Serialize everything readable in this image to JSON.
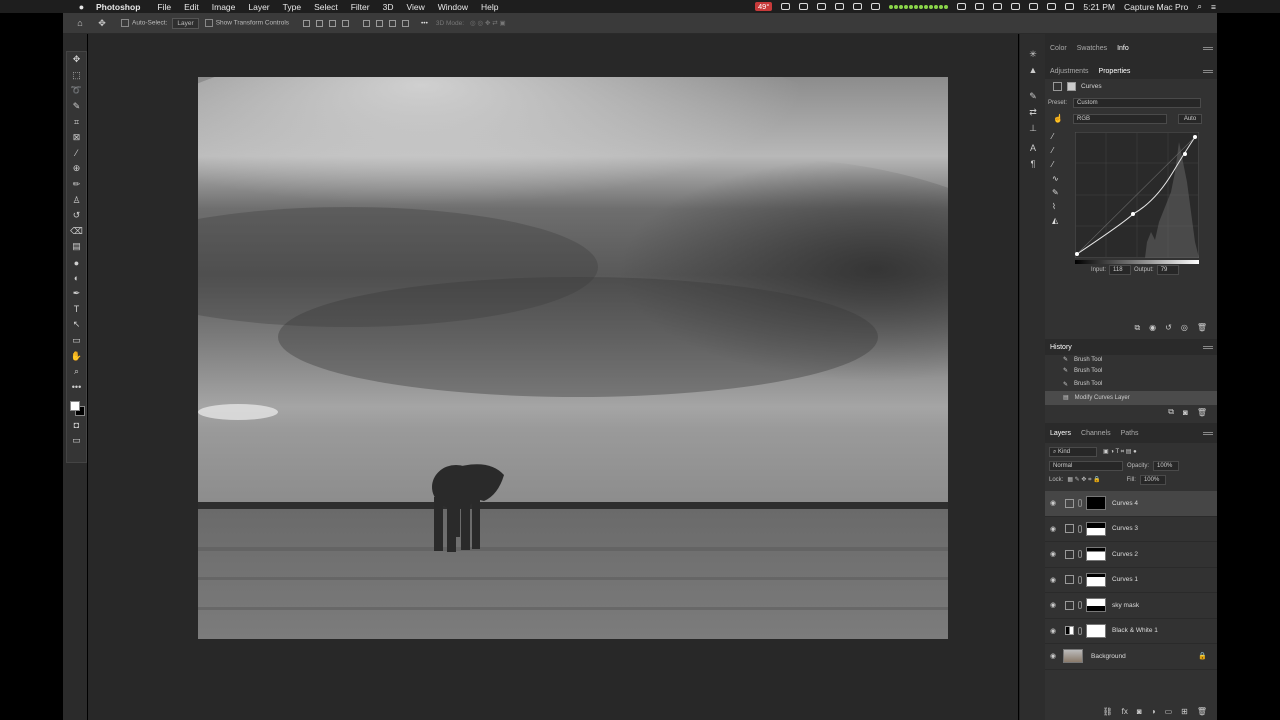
{
  "menubar": {
    "app_name": "Photoshop",
    "items": [
      "File",
      "Edit",
      "Image",
      "Layer",
      "Type",
      "Select",
      "Filter",
      "3D",
      "View",
      "Window",
      "Help"
    ],
    "temperature": "49°",
    "time": "5:21 PM",
    "user": "Capture Mac Pro"
  },
  "options": {
    "auto_select_label": "Auto-Select:",
    "auto_select_value": "Layer",
    "show_transform_label": "Show Transform Controls",
    "mode_3d": "3D Mode:"
  },
  "tools": [
    "move",
    "marquee",
    "lasso",
    "quick-select",
    "crop",
    "frame",
    "eyedropper",
    "healing",
    "brush",
    "stamp",
    "history-brush",
    "eraser",
    "gradient",
    "blur",
    "dodge",
    "pen",
    "type",
    "path-select",
    "shape",
    "hand",
    "zoom",
    "more"
  ],
  "panel_top": {
    "tabs": [
      "Color",
      "Swatches",
      "Info"
    ],
    "active_tab": "Info"
  },
  "properties": {
    "tabs": [
      "Adjustments",
      "Properties"
    ],
    "active_tab": "Properties",
    "title": "Curves",
    "preset_label": "Preset:",
    "preset_value": "Custom",
    "channel": "RGB",
    "auto_label": "Auto",
    "input_label": "Input:",
    "input_value": "118",
    "output_label": "Output:",
    "output_value": "79"
  },
  "history": {
    "title": "History",
    "items": [
      "Brush Tool",
      "Brush Tool",
      "Brush Tool",
      "Modify Curves Layer"
    ]
  },
  "layers": {
    "tabs": [
      "Layers",
      "Channels",
      "Paths"
    ],
    "active_tab": "Layers",
    "filter_label": "Kind",
    "blend_mode": "Normal",
    "opacity_label": "Opacity:",
    "opacity_value": "100%",
    "lock_label": "Lock:",
    "fill_label": "Fill:",
    "fill_value": "100%",
    "items": [
      {
        "name": "Curves 4",
        "selected": true
      },
      {
        "name": "Curves 3",
        "selected": false
      },
      {
        "name": "Curves 2",
        "selected": false
      },
      {
        "name": "Curves 1",
        "selected": false
      },
      {
        "name": "sky mask",
        "selected": false
      },
      {
        "name": "Black & White 1",
        "selected": false
      },
      {
        "name": "Background",
        "selected": false
      }
    ]
  }
}
